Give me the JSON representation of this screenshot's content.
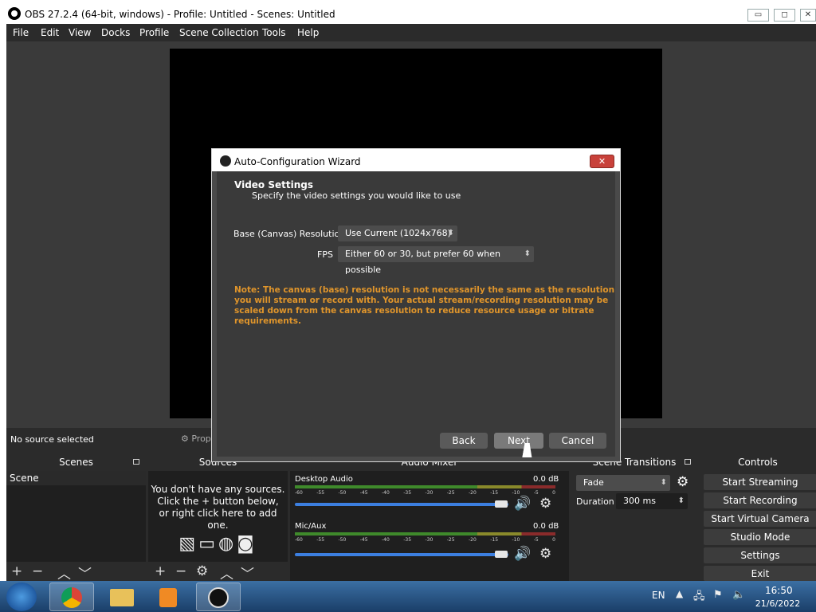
{
  "window": {
    "title": "OBS 27.2.4 (64-bit, windows) - Profile: Untitled - Scenes: Untitled",
    "min": "▭",
    "restore": "◻",
    "close": "✕"
  },
  "menu": [
    "File",
    "Edit",
    "View",
    "Docks",
    "Profile",
    "Scene Collection",
    "Tools",
    "Help"
  ],
  "source_bar": {
    "status": "No source selected",
    "properties": "Properties"
  },
  "docks": {
    "scenes": {
      "title": "Scenes",
      "items": [
        "Scene"
      ]
    },
    "sources": {
      "title": "Sources",
      "empty_lines": [
        "You don't have any sources.",
        "Click the + button below,",
        "or right click here to add one."
      ]
    },
    "mixer": {
      "title": "Audio Mixer",
      "channels": [
        {
          "name": "Desktop Audio",
          "level": "0.0 dB",
          "volume": 1.0
        },
        {
          "name": "Mic/Aux",
          "level": "0.0 dB",
          "volume": 1.0
        }
      ],
      "ticks": [
        "-60",
        "-55",
        "-50",
        "-45",
        "-40",
        "-35",
        "-30",
        "-25",
        "-20",
        "-15",
        "-10",
        "-5",
        "0"
      ]
    },
    "transitions": {
      "title": "Scene Transitions",
      "transition": "Fade",
      "duration_label": "Duration",
      "duration": "300 ms"
    },
    "controls": {
      "title": "Controls",
      "buttons": [
        "Start Streaming",
        "Start Recording",
        "Start Virtual Camera",
        "Studio Mode",
        "Settings",
        "Exit"
      ]
    }
  },
  "dialog": {
    "title": "Auto-Configuration Wizard",
    "close": "✕",
    "heading": "Video Settings",
    "subheading": "Specify the video settings you would like to use",
    "resolution_label": "Base (Canvas) Resolution",
    "resolution_value": "Use Current (1024x768)",
    "fps_label": "FPS",
    "fps_value": "Either 60 or 30, but prefer 60 when possible",
    "note_lines": [
      "Note: The canvas (base) resolution is not necessarily the same as the resolution",
      "you will stream or record with. Your actual stream/recording resolution may be",
      "scaled down from the canvas resolution to reduce resource usage or bitrate",
      "requirements."
    ],
    "note_color": "#e0952b",
    "back": "Back",
    "next": "Next",
    "cancel": "Cancel"
  },
  "taskbar": {
    "lang": "EN",
    "time": "16:50",
    "date": "21/6/2022"
  }
}
